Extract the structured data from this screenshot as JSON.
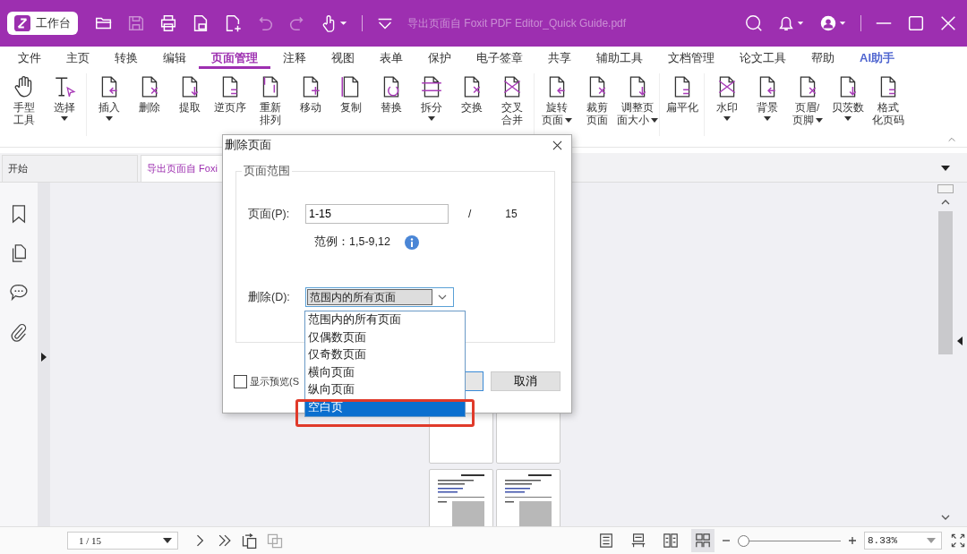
{
  "title_bar": {
    "workspace_button": "工作台",
    "document_title": "导出页面自 Foxit PDF Editor_Quick Guide.pdf"
  },
  "menu_tabs": [
    {
      "label": "文件",
      "selected": false,
      "kind": "plain"
    },
    {
      "label": "主页",
      "selected": false,
      "kind": "plain"
    },
    {
      "label": "转换",
      "selected": false,
      "kind": "plain"
    },
    {
      "label": "编辑",
      "selected": false,
      "kind": "plain"
    },
    {
      "label": "页面管理",
      "selected": true,
      "kind": "plain"
    },
    {
      "label": "注释",
      "selected": false,
      "kind": "plain"
    },
    {
      "label": "视图",
      "selected": false,
      "kind": "plain"
    },
    {
      "label": "表单",
      "selected": false,
      "kind": "plain"
    },
    {
      "label": "保护",
      "selected": false,
      "kind": "plain"
    },
    {
      "label": "电子签章",
      "selected": false,
      "kind": "plain"
    },
    {
      "label": "共享",
      "selected": false,
      "kind": "plain"
    },
    {
      "label": "辅助工具",
      "selected": false,
      "kind": "plain"
    },
    {
      "label": "文档管理",
      "selected": false,
      "kind": "plain"
    },
    {
      "label": "论文工具",
      "selected": false,
      "kind": "plain"
    },
    {
      "label": "帮助",
      "selected": false,
      "kind": "plain"
    },
    {
      "label": "AI助手",
      "selected": false,
      "kind": "ai"
    }
  ],
  "ribbon_groups": [
    [
      {
        "lines": [
          "手型",
          "工具"
        ],
        "kind": "plain"
      },
      {
        "lines": [
          "选择"
        ],
        "kind": "menu"
      }
    ],
    [
      {
        "lines": [
          "插入"
        ],
        "kind": "menu"
      },
      {
        "lines": [
          "删除"
        ],
        "kind": "plain"
      },
      {
        "lines": [
          "提取"
        ],
        "kind": "plain"
      },
      {
        "lines": [
          "逆页序"
        ],
        "kind": "plain"
      },
      {
        "lines": [
          "重新",
          "排列"
        ],
        "kind": "plain"
      },
      {
        "lines": [
          "移动"
        ],
        "kind": "plain"
      },
      {
        "lines": [
          "复制"
        ],
        "kind": "plain"
      },
      {
        "lines": [
          "替换"
        ],
        "kind": "plain"
      },
      {
        "lines": [
          "拆分"
        ],
        "kind": "menu"
      },
      {
        "lines": [
          "交换"
        ],
        "kind": "plain"
      },
      {
        "lines": [
          "交叉",
          "合并"
        ],
        "kind": "plain"
      }
    ],
    [
      {
        "lines": [
          "旋转",
          "页面"
        ],
        "kind": "inline"
      },
      {
        "lines": [
          "裁剪",
          "页面"
        ],
        "kind": "plain"
      },
      {
        "lines": [
          "调整页",
          "面大小"
        ],
        "kind": "inline"
      }
    ],
    [
      {
        "lines": [
          "扁平化"
        ],
        "kind": "plain"
      }
    ],
    [
      {
        "lines": [
          "水印"
        ],
        "kind": "menu"
      },
      {
        "lines": [
          "背景"
        ],
        "kind": "menu"
      },
      {
        "lines": [
          "页眉/",
          "页脚"
        ],
        "kind": "inline"
      },
      {
        "lines": [
          "贝茨数"
        ],
        "kind": "menu"
      },
      {
        "lines": [
          "格式",
          "化页码"
        ],
        "kind": "plain"
      }
    ]
  ],
  "doc_tabs": [
    {
      "label": "开始",
      "selected": false
    },
    {
      "label": "导出页面自 Foxi",
      "selected": true
    }
  ],
  "thumbnails": [
    {
      "kind": "blank"
    },
    {
      "kind": "blank"
    },
    {
      "kind": "text"
    },
    {
      "kind": "text"
    }
  ],
  "dialog": {
    "title": "删除页面",
    "group_label": "页面范围",
    "pages_label": "页面(P):",
    "pages_value": "1-15",
    "separator": "/",
    "total": "15",
    "example": "范例：1,5-9,12",
    "delete_label": "删除(D):",
    "delete_value": "范围内的所有页面",
    "options": [
      {
        "label": "范围内的所有页面",
        "selected": false
      },
      {
        "label": "仅偶数页面",
        "selected": false
      },
      {
        "label": "仅奇数页面",
        "selected": false
      },
      {
        "label": "横向页面",
        "selected": false
      },
      {
        "label": "纵向页面",
        "selected": false
      },
      {
        "label": "空白页",
        "selected": true
      }
    ],
    "preview": {
      "label": "显示预览(S",
      "checked": false
    },
    "cancel_button": "取消"
  },
  "status_bar": {
    "page_field": "1 / 15",
    "view_modes": [
      {
        "selected": false
      },
      {
        "selected": false
      },
      {
        "selected": false
      },
      {
        "selected": true
      }
    ],
    "zoom": {
      "level": 0.05
    },
    "zoom_value": "8.33%"
  }
}
